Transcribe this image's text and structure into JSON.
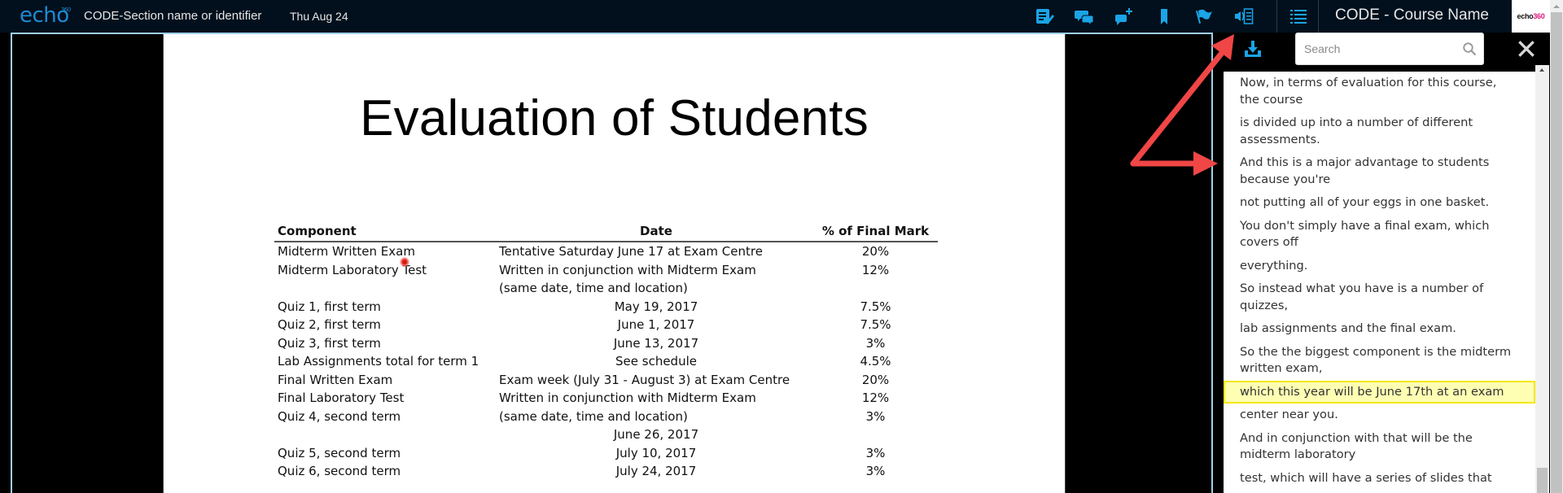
{
  "header": {
    "logo": "echo",
    "logo_sup": "360",
    "section_name": "CODE-Section name or identifier",
    "date": "Thu Aug 24",
    "course_name": "CODE - Course Name",
    "brand_text": "echo",
    "brand_sup": "360",
    "tools": [
      {
        "name": "notes",
        "icon": "notes-icon"
      },
      {
        "name": "discussions",
        "icon": "discussion-icon"
      },
      {
        "name": "ask-question",
        "icon": "add-question-icon"
      },
      {
        "name": "bookmark",
        "icon": "bookmark-icon"
      },
      {
        "name": "flag",
        "icon": "flag-icon"
      },
      {
        "name": "transcript",
        "icon": "transcript-icon"
      },
      {
        "name": "outline",
        "icon": "list-icon"
      }
    ],
    "accent_color": "#1ba4e6"
  },
  "slide": {
    "title": "Evaluation of Students",
    "columns": [
      "Component",
      "Date",
      "% of Final Mark"
    ],
    "rows": [
      {
        "component": "Midterm Written Exam",
        "date": "Tentative Saturday June 17 at Exam Centre",
        "mark": "20%",
        "align": "left"
      },
      {
        "component": "Midterm Laboratory Test",
        "date": "Written in conjunction with Midterm Exam",
        "mark": "12%",
        "align": "left"
      },
      {
        "component": "",
        "date": "(same date, time and location)",
        "mark": "",
        "align": "left"
      },
      {
        "component": "Quiz 1, first term",
        "date": "May 19, 2017",
        "mark": "7.5%",
        "align": "center"
      },
      {
        "component": "Quiz 2, first term",
        "date": "June 1, 2017",
        "mark": "7.5%",
        "align": "center"
      },
      {
        "component": "Quiz 3, first term",
        "date": "June 13, 2017",
        "mark": "3%",
        "align": "center"
      },
      {
        "component": "Lab Assignments total for term 1",
        "date": "See schedule",
        "mark": "4.5%",
        "align": "center"
      },
      {
        "component": "Final Written Exam",
        "date": "Exam week (July 31 - August 3) at Exam Centre",
        "mark": "20%",
        "align": "left"
      },
      {
        "component": "Final Laboratory Test",
        "date": "Written in conjunction with Midterm Exam",
        "mark": "12%",
        "align": "left"
      },
      {
        "component": "Quiz 4, second term",
        "date": "(same date, time and location)",
        "mark": "3%",
        "align": "left"
      },
      {
        "component": "",
        "date": "June 26, 2017",
        "mark": "",
        "align": "center"
      },
      {
        "component": "Quiz 5, second term",
        "date": "July 10, 2017",
        "mark": "3%",
        "align": "center"
      },
      {
        "component": "Quiz 6, second term",
        "date": "July 24, 2017",
        "mark": "3%",
        "align": "center"
      }
    ]
  },
  "panel": {
    "search_placeholder": "Search",
    "search_value": "",
    "highlight_color": "#ffffb4",
    "transcript": [
      {
        "text": "Now, in terms of evaluation for this course, the course",
        "active": false
      },
      {
        "text": "is divided up into a number of different assessments.",
        "active": false
      },
      {
        "text": "And this is a major advantage to students because you're",
        "active": false
      },
      {
        "text": "not putting all of your eggs in one basket.",
        "active": false
      },
      {
        "text": "You don't simply have a final exam, which covers off",
        "active": false
      },
      {
        "text": "everything.",
        "active": false
      },
      {
        "text": "So instead what you have is a number of quizzes,",
        "active": false
      },
      {
        "text": "lab assignments and the final exam.",
        "active": false
      },
      {
        "text": "So the the biggest component is the midterm written exam,",
        "active": false
      },
      {
        "text": "which this year will be June 17th at an exam",
        "active": true
      },
      {
        "text": "center near you.",
        "active": false
      },
      {
        "text": "And in conjunction with that will be the midterm laboratory",
        "active": false
      },
      {
        "text": "test, which will have a series of slides that",
        "active": false
      }
    ]
  },
  "annotation": {
    "color": "#f04646",
    "description": "red arrows pointing to transcript toggle and transcript panel"
  }
}
